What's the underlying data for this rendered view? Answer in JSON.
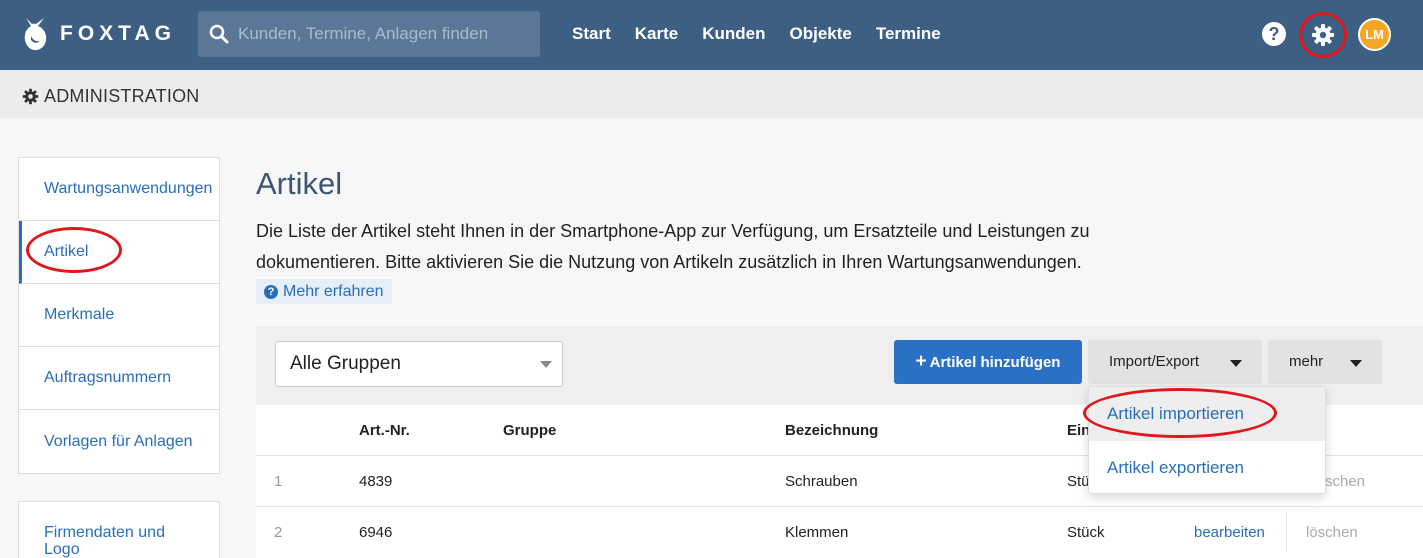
{
  "brand": {
    "name": "FOXTAG"
  },
  "search": {
    "placeholder": "Kunden, Termine, Anlagen finden"
  },
  "nav": [
    "Start",
    "Karte",
    "Kunden",
    "Objekte",
    "Termine"
  ],
  "user": {
    "initials": "LM"
  },
  "help": {
    "glyph": "?"
  },
  "admin": {
    "title": "ADMINISTRATION"
  },
  "sidebar": {
    "group1": [
      "Wartungsanwendungen",
      "Artikel",
      "Merkmale",
      "Auftragsnummern",
      "Vorlagen für Anlagen"
    ],
    "group2": [
      "Firmendaten und Logo"
    ],
    "active": "Artikel"
  },
  "main": {
    "title": "Artikel",
    "description": "Die Liste der Artikel steht Ihnen in der Smartphone-App zur Verfügung, um Ersatzteile und Leistungen zu dokumentieren. Bitte aktivieren Sie die Nutzung von Artikeln zusätzlich in Ihren Wartungsanwendungen.",
    "more_link": "Mehr erfahren"
  },
  "toolbar": {
    "group_select": "Alle Gruppen",
    "add_button": "Artikel hinzufügen",
    "import_export": "Import/Export",
    "more": "mehr"
  },
  "dropdown": [
    "Artikel importieren",
    "Artikel exportieren"
  ],
  "table": {
    "headers": [
      "Art.-Nr.",
      "Gruppe",
      "Bezeichnung",
      "Ein"
    ],
    "rows": [
      {
        "index": "1",
        "art_nr": "4839",
        "gruppe": "",
        "bezeichnung": "Schrauben",
        "einheit": "Stü",
        "edit": "",
        "delete": "schen"
      },
      {
        "index": "2",
        "art_nr": "6946",
        "gruppe": "",
        "bezeichnung": "Klemmen",
        "einheit": "Stück",
        "edit": "bearbeiten",
        "delete": "löschen"
      }
    ]
  },
  "colors": {
    "topbar": "#3d5f83",
    "accent": "#2a70c4",
    "link": "#2a6ebb",
    "highlight": "#e0171b",
    "avatar": "#f5a623"
  }
}
